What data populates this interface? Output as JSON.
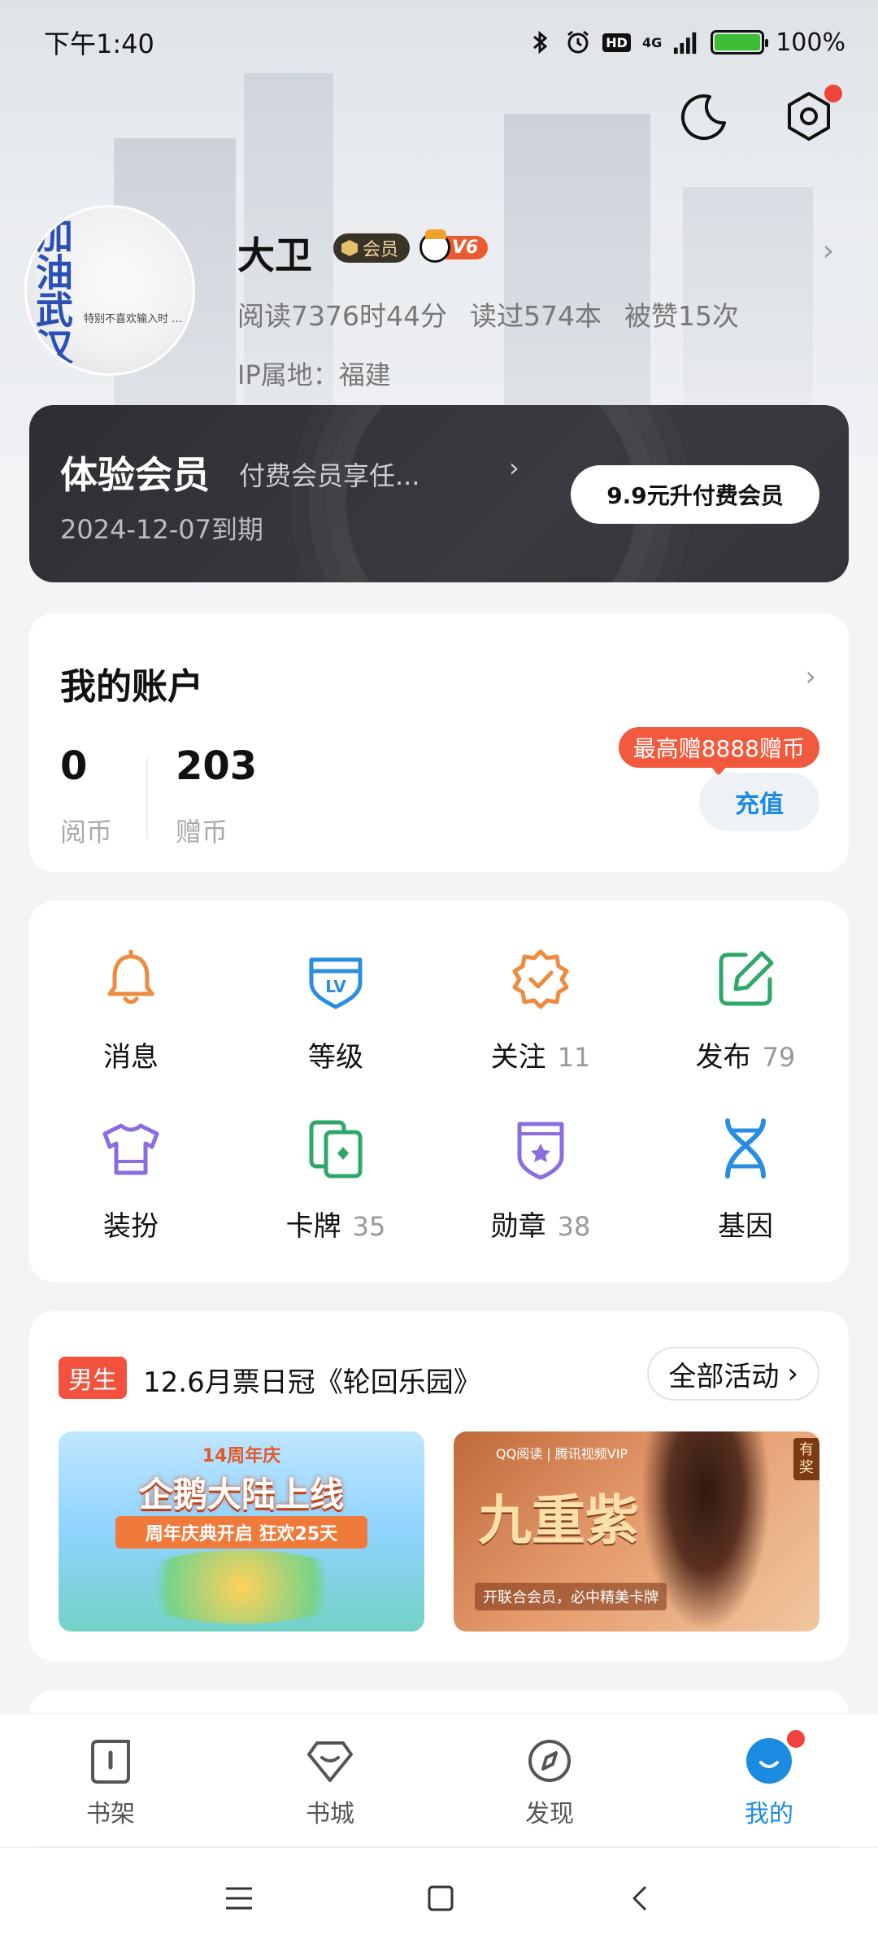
{
  "status_bar": {
    "time": "下午1:40",
    "network": "4G",
    "hd": "HD",
    "battery": "100%",
    "battery_level": 1.0
  },
  "top_icons": [
    "moon-icon",
    "settings-icon"
  ],
  "profile": {
    "avatar_caption": "加油武汉",
    "avatar_sub": "特别不喜欢输入时 …",
    "name": "大卫",
    "vip_label": "会员",
    "level_label": "V6",
    "stats": [
      "阅读7376时44分",
      "读过574本",
      "被赞15次"
    ],
    "ip": "IP属地：福建"
  },
  "member": {
    "title": "体验会员",
    "desc": "付费会员享任...",
    "arrow": "›",
    "expire": "2024-12-07到期",
    "upgrade_label": "9.9元升付费会员"
  },
  "account": {
    "title": "我的账户",
    "yuebi_value": "0",
    "yuebi_label": "阅币",
    "zengbi_value": "203",
    "zengbi_label": "赠币",
    "bonus_tip": "最高赠8888赠币",
    "recharge_label": "充值"
  },
  "features": [
    {
      "label": "消息",
      "count": "",
      "icon": "bell-icon",
      "color": "#ef8a3e"
    },
    {
      "label": "等级",
      "count": "",
      "icon": "level-icon",
      "color": "#2a8de0"
    },
    {
      "label": "关注",
      "count": "11",
      "icon": "follow-badge-icon",
      "color": "#ef8a3e"
    },
    {
      "label": "发布",
      "count": "79",
      "icon": "edit-icon",
      "color": "#2ea86a"
    },
    {
      "label": "装扮",
      "count": "",
      "icon": "shirt-icon",
      "color": "#8a6ee0"
    },
    {
      "label": "卡牌",
      "count": "35",
      "icon": "cards-icon",
      "color": "#2ea86a"
    },
    {
      "label": "勋章",
      "count": "38",
      "icon": "medal-icon",
      "color": "#8a6ee0"
    },
    {
      "label": "基因",
      "count": "",
      "icon": "dna-icon",
      "color": "#2a8de0"
    }
  ],
  "activity": {
    "tag": "男生",
    "title": "12.6月票日冠《轮回乐园》",
    "all_label": "全部活动",
    "banner1": {
      "top": "14周年庆",
      "main": "企鹅大陆上线",
      "sub": "周年庆典开启 狂欢25天"
    },
    "banner2": {
      "logos": "QQ阅读 | 腾讯视频VIP",
      "title": "九重紫",
      "sub": "开联合会员，必中精美卡牌",
      "prize": "有奖"
    }
  },
  "bottom_nav": [
    {
      "label": "书架",
      "icon": "bookshelf-icon",
      "active": false
    },
    {
      "label": "书城",
      "icon": "bookstore-icon",
      "active": false
    },
    {
      "label": "发现",
      "icon": "discover-icon",
      "active": false
    },
    {
      "label": "我的",
      "icon": "mine-icon",
      "active": true
    }
  ],
  "colors": {
    "accent": "#1a8be0",
    "red": "#f25a3e",
    "member_card": "#2d2e33"
  }
}
